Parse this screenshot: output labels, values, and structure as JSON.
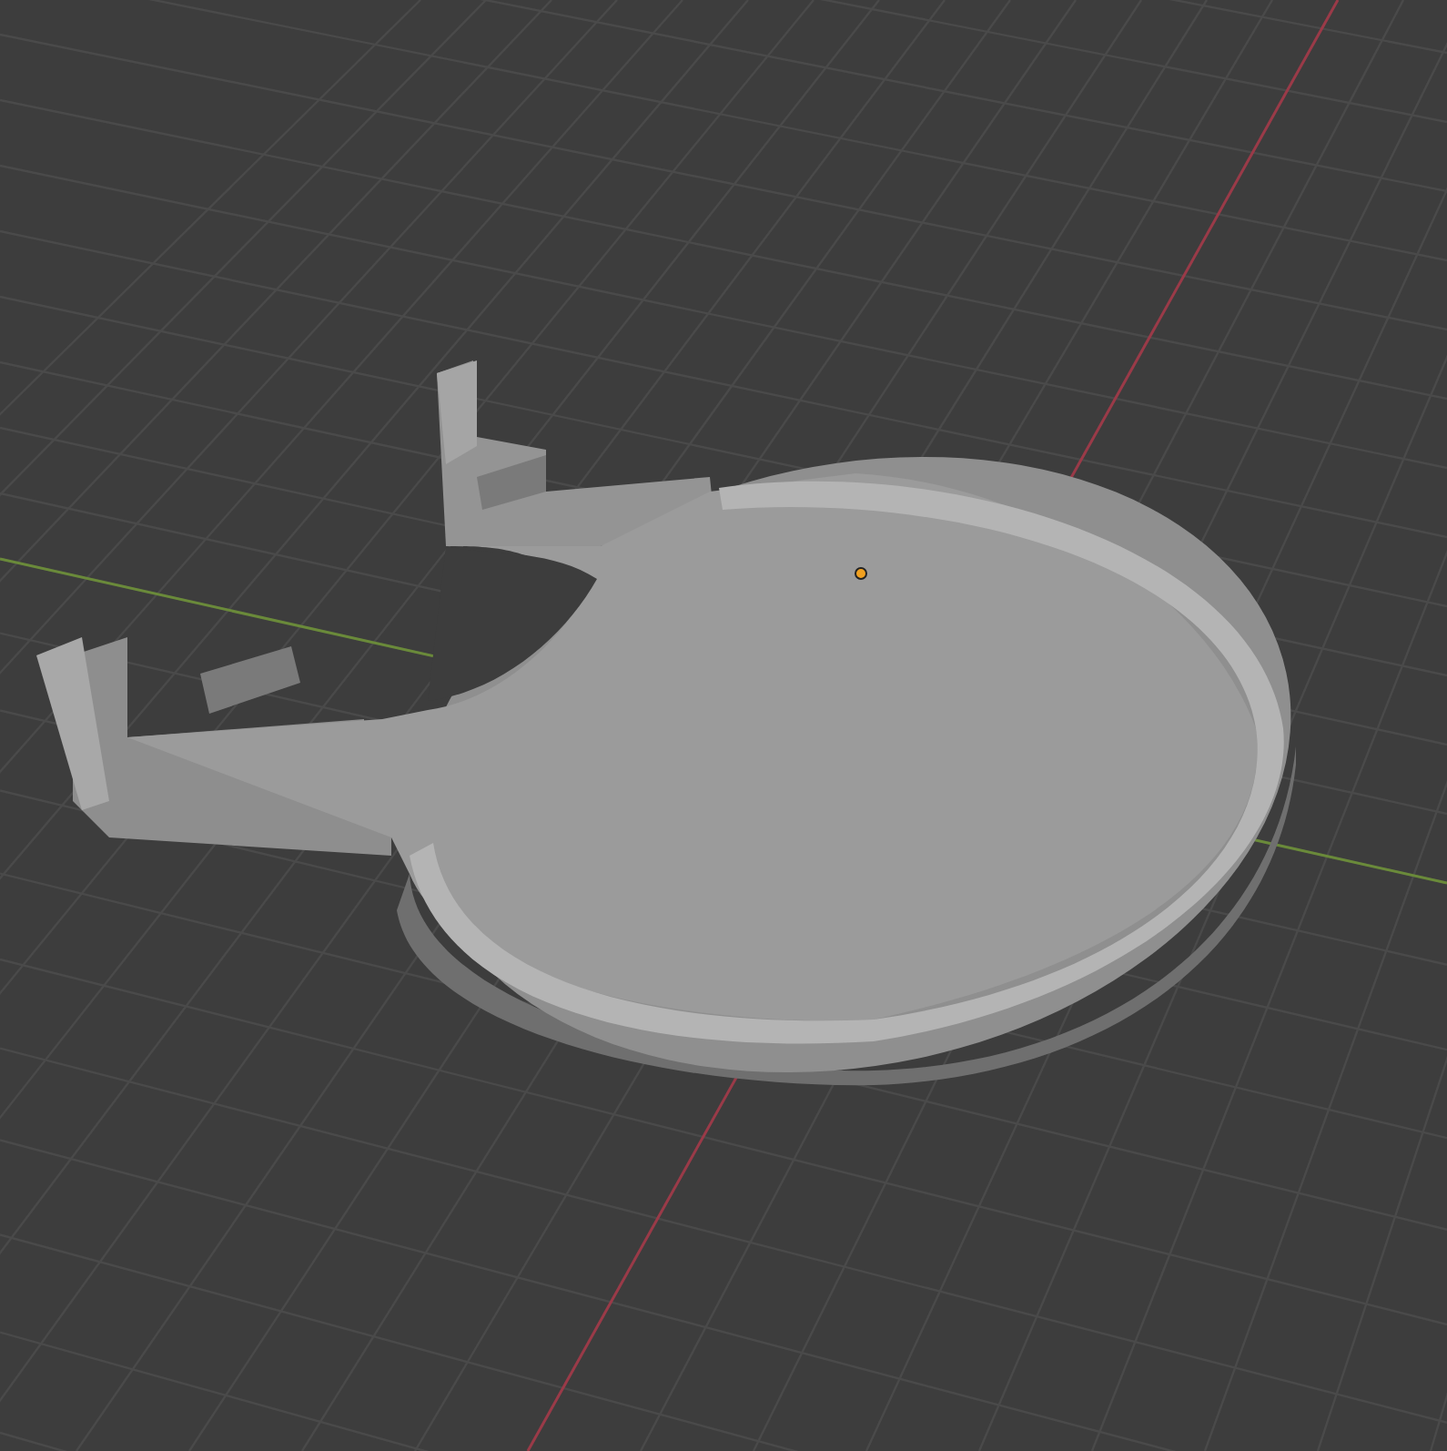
{
  "viewport": {
    "kind": "perspective-grid"
  }
}
